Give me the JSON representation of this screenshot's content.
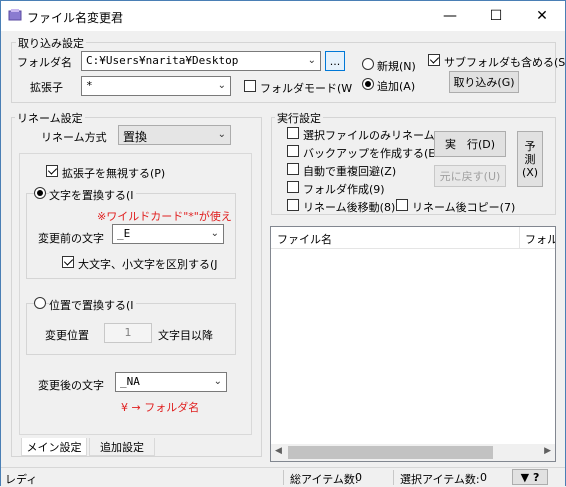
{
  "window": {
    "title": "ファイル名変更君"
  },
  "import_group": {
    "title": "取り込み設定",
    "folder_label": "フォルダ名",
    "folder_value": "C:¥Users¥narita¥Desktop",
    "browse_label": "...",
    "ext_label": "拡張子",
    "ext_value": "*",
    "folder_mode_label": "フォルダモード(W",
    "mode_new_label": "新規(N)",
    "mode_add_label": "追加(A)",
    "mode_selected": "add",
    "include_sub_label": "サブフォルダも含める(S",
    "include_sub_checked": true,
    "import_button": "取り込み(G)"
  },
  "rename_group": {
    "title": "リネーム設定",
    "method_label": "リネーム方式",
    "method_value": "置換",
    "ignore_ext_label": "拡張子を無視する(P)",
    "ignore_ext_checked": true,
    "replace_text_label": "文字を置換する(I",
    "wildcard_note": "※ワイルドカード\"*\"が使え",
    "before_label": "変更前の文字",
    "before_value": "_E",
    "case_label": "大文字、小文字を区別する(J",
    "case_checked": true,
    "replace_pos_label": "位置で置換する(I",
    "pos_label": "変更位置",
    "pos_value": "1",
    "pos_suffix": "文字目以降",
    "after_label": "変更後の文字",
    "after_value": "_NA",
    "folder_note": "¥ → フォルダ名",
    "selected_mode": "text"
  },
  "tabs": [
    "メイン設定",
    "追加設定"
  ],
  "exec_group": {
    "title": "実行設定",
    "opt_selected_only": "選択ファイルのみリネーム(",
    "opt_backup": "バックアップを作成する(E",
    "opt_avoid_dup": "自動で重複回避(Z)",
    "opt_create_folder": "フォルダ作成(9)",
    "opt_move": "リネーム後移動(8)",
    "opt_copy": "リネーム後コピー(7)",
    "run_button": "実　行(D)",
    "undo_button": "元に戻す(U)",
    "preview_button_top": "予",
    "preview_button_mid": "測",
    "preview_button_bottom": "(X)"
  },
  "list": {
    "columns": [
      "ファイル名",
      "フォル"
    ]
  },
  "status": {
    "ready": "レディ",
    "total_label": "総アイテム数:",
    "total_value": "0",
    "selected_label": "選択アイテム数:",
    "selected_value": "0",
    "help_label": "▼ ?"
  }
}
